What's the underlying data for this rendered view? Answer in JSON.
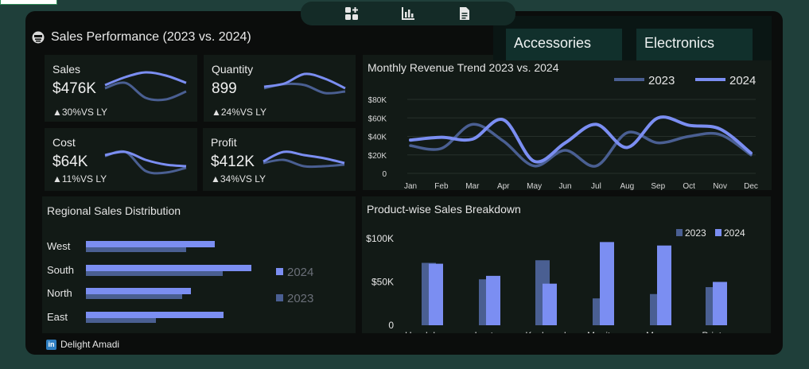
{
  "dashboard": {
    "title": "Sales Performance (2023 vs. 2024)"
  },
  "slicer": {
    "items": [
      "Accessories",
      "Electronics"
    ]
  },
  "kpis": [
    {
      "label": "Sales",
      "value": "$476K",
      "delta": "▲30%VS LY",
      "spark_2023": [
        0.55,
        0.8,
        0.95,
        0.85,
        0.62
      ],
      "spark_2024": [
        0.45,
        0.62,
        0.15,
        0.1,
        0.35
      ]
    },
    {
      "label": "Quantity",
      "value": "899",
      "delta": "▲24%VS LY",
      "spark_2023": [
        0.5,
        0.6,
        0.9,
        0.75,
        0.45
      ],
      "spark_2024": [
        0.45,
        0.58,
        0.55,
        0.3,
        0.35
      ]
    },
    {
      "label": "Cost",
      "value": "$64K",
      "delta": "▲11%VS LY",
      "spark_2023": [
        0.85,
        0.95,
        0.7,
        0.55,
        0.5
      ],
      "spark_2024": [
        0.82,
        0.95,
        0.35,
        0.3,
        0.45
      ]
    },
    {
      "label": "Profit",
      "value": "$412K",
      "delta": "▲34%VS LY",
      "spark_2023": [
        0.5,
        0.8,
        0.7,
        0.6,
        0.45
      ],
      "spark_2024": [
        0.45,
        0.55,
        0.35,
        0.35,
        0.4
      ]
    }
  ],
  "revenue_trend": {
    "title": "Monthly Revenue Trend 2023 vs. 2024"
  },
  "regional": {
    "title": "Regional Sales Distribution"
  },
  "product": {
    "title": "Product-wise Sales Breakdown"
  },
  "credit": {
    "icon": "linkedin-icon",
    "name": "Delight Amadi"
  },
  "toolbar": {
    "icons": [
      "add-widget-icon",
      "bar-chart-icon",
      "document-icon"
    ]
  },
  "colors": {
    "y2023": "#4a5f92",
    "y2024": "#7b8ef2",
    "panel": "#121a16",
    "background": "#0b0d0c"
  },
  "chart_data": [
    {
      "type": "line",
      "title": "Monthly Revenue Trend 2023 vs. 2024",
      "categories": [
        "Jan",
        "Feb",
        "Mar",
        "Apr",
        "May",
        "Jun",
        "Jul",
        "Aug",
        "Sep",
        "Oct",
        "Nov",
        "Dec"
      ],
      "series": [
        {
          "name": "2023",
          "values": [
            30000,
            27000,
            53000,
            35000,
            8000,
            25000,
            8000,
            44000,
            33000,
            40000,
            42000,
            20000
          ]
        },
        {
          "name": "2024",
          "values": [
            36000,
            39000,
            37000,
            58000,
            13000,
            33000,
            53000,
            28000,
            60000,
            52000,
            48000,
            22000
          ]
        }
      ],
      "y_ticks": [
        "$80K",
        "$60K",
        "$40K",
        "$20K",
        "0"
      ],
      "ylim": [
        0,
        80000
      ],
      "grid": true,
      "legend": "top-right"
    },
    {
      "type": "bar",
      "orientation": "horizontal",
      "title": "Regional Sales Distribution",
      "categories": [
        "West",
        "South",
        "North",
        "East"
      ],
      "series": [
        {
          "name": "2024",
          "values": [
            162,
            208,
            132,
            173
          ]
        },
        {
          "name": "2023",
          "values": [
            126,
            172,
            121,
            88
          ]
        }
      ],
      "xlim": [
        0,
        220
      ],
      "legend": "right"
    },
    {
      "type": "bar",
      "title": "Product-wise Sales Breakdown",
      "categories": [
        "Headphones",
        "Laptop",
        "Keyboard",
        "Monitor",
        "Mouse",
        "Printer"
      ],
      "series": [
        {
          "name": "2023",
          "values": [
            72000,
            53000,
            75000,
            31000,
            36000,
            44000
          ]
        },
        {
          "name": "2024",
          "values": [
            71000,
            57000,
            48000,
            96000,
            92000,
            50000
          ]
        }
      ],
      "y_ticks": [
        "$100K",
        "$50K",
        "0"
      ],
      "ylim": [
        0,
        100000
      ],
      "legend": "top-right"
    }
  ]
}
